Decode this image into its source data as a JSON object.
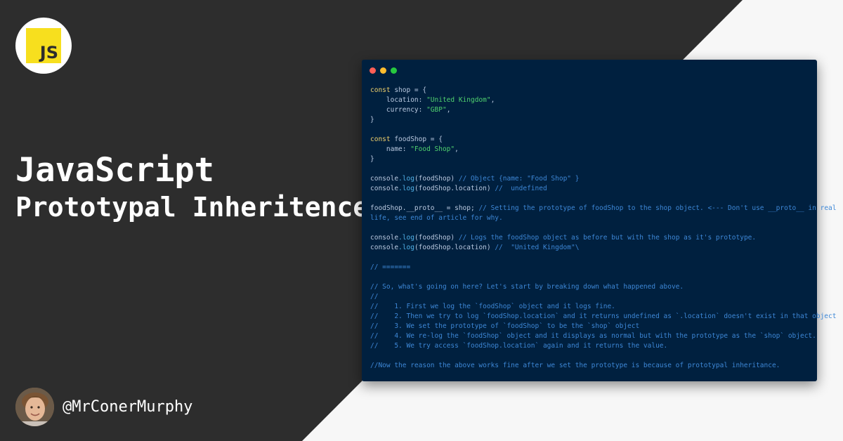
{
  "brand": {
    "logo_text": "JS"
  },
  "headline": {
    "title": "JavaScript",
    "subtitle": "Prototypal Inheritence"
  },
  "author": {
    "handle": "@MrConerMurphy"
  },
  "colors": {
    "background_dark": "#2d2d2d",
    "background_light": "#f7f7f7",
    "editor_bg": "#00203f",
    "js_yellow": "#f7df1e",
    "dot_red": "#ff5f56",
    "dot_yellow": "#ffbd2e",
    "dot_green": "#27c93f"
  },
  "editor": {
    "window_dots": [
      "close",
      "minimize",
      "maximize"
    ],
    "lines": [
      [
        {
          "t": "const",
          "c": "key"
        },
        {
          "t": " shop = {",
          "c": "def"
        }
      ],
      [
        {
          "t": "    location: ",
          "c": "def"
        },
        {
          "t": "\"United Kingdom\"",
          "c": "str"
        },
        {
          "t": ",",
          "c": "def"
        }
      ],
      [
        {
          "t": "    currency: ",
          "c": "def"
        },
        {
          "t": "\"GBP\"",
          "c": "str"
        },
        {
          "t": ",",
          "c": "def"
        }
      ],
      [
        {
          "t": "}",
          "c": "def"
        }
      ],
      [],
      [
        {
          "t": "const",
          "c": "key"
        },
        {
          "t": " foodShop = {",
          "c": "def"
        }
      ],
      [
        {
          "t": "    name: ",
          "c": "def"
        },
        {
          "t": "\"Food Shop\"",
          "c": "str"
        },
        {
          "t": ",",
          "c": "def"
        }
      ],
      [
        {
          "t": "}",
          "c": "def"
        }
      ],
      [],
      [
        {
          "t": "console",
          "c": "def"
        },
        {
          "t": ".log",
          "c": "fn"
        },
        {
          "t": "(foodShop) ",
          "c": "def"
        },
        {
          "t": "// Object {name: \"Food Shop\" }",
          "c": "cmt"
        }
      ],
      [
        {
          "t": "console",
          "c": "def"
        },
        {
          "t": ".log",
          "c": "fn"
        },
        {
          "t": "(foodShop.location) ",
          "c": "def"
        },
        {
          "t": "//  undefined",
          "c": "cmt"
        }
      ],
      [],
      [
        {
          "t": "foodShop.__proto__ = shop; ",
          "c": "def"
        },
        {
          "t": "// Setting the prototype of foodShop to the shop object. <--- Don't use __proto__ in real",
          "c": "cmt"
        }
      ],
      [
        {
          "t": "life, see end of article for why.",
          "c": "cmt"
        }
      ],
      [],
      [
        {
          "t": "console",
          "c": "def"
        },
        {
          "t": ".log",
          "c": "fn"
        },
        {
          "t": "(foodShop) ",
          "c": "def"
        },
        {
          "t": "// Logs the foodShop object as before but with the shop as it's prototype.",
          "c": "cmt"
        }
      ],
      [
        {
          "t": "console",
          "c": "def"
        },
        {
          "t": ".log",
          "c": "fn"
        },
        {
          "t": "(foodShop.location) ",
          "c": "def"
        },
        {
          "t": "//  \"United Kingdom\"\\",
          "c": "cmt"
        }
      ],
      [],
      [
        {
          "t": "// =======",
          "c": "cmt"
        }
      ],
      [],
      [
        {
          "t": "// So, what's going on here? Let's start by breaking down what happened above.",
          "c": "cmt"
        }
      ],
      [
        {
          "t": "//",
          "c": "cmt"
        }
      ],
      [
        {
          "t": "//    1. First we log the `foodShop` object and it logs fine.",
          "c": "cmt"
        }
      ],
      [
        {
          "t": "//    2. Then we try to log `foodShop.location` and it returns undefined as `.location` doesn't exist in that object",
          "c": "cmt"
        }
      ],
      [
        {
          "t": "//    3. We set the prototype of `foodShop` to be the `shop` object",
          "c": "cmt"
        }
      ],
      [
        {
          "t": "//    4. We re-log the `foodShop` object and it displays as normal but with the prototype as the `shop` object.",
          "c": "cmt"
        }
      ],
      [
        {
          "t": "//    5. We try access `foodShop.location` again and it returns the value.",
          "c": "cmt"
        }
      ],
      [],
      [
        {
          "t": "//Now the reason the above works fine after we set the prototype is because of prototypal inheritance.",
          "c": "cmt"
        }
      ]
    ]
  }
}
